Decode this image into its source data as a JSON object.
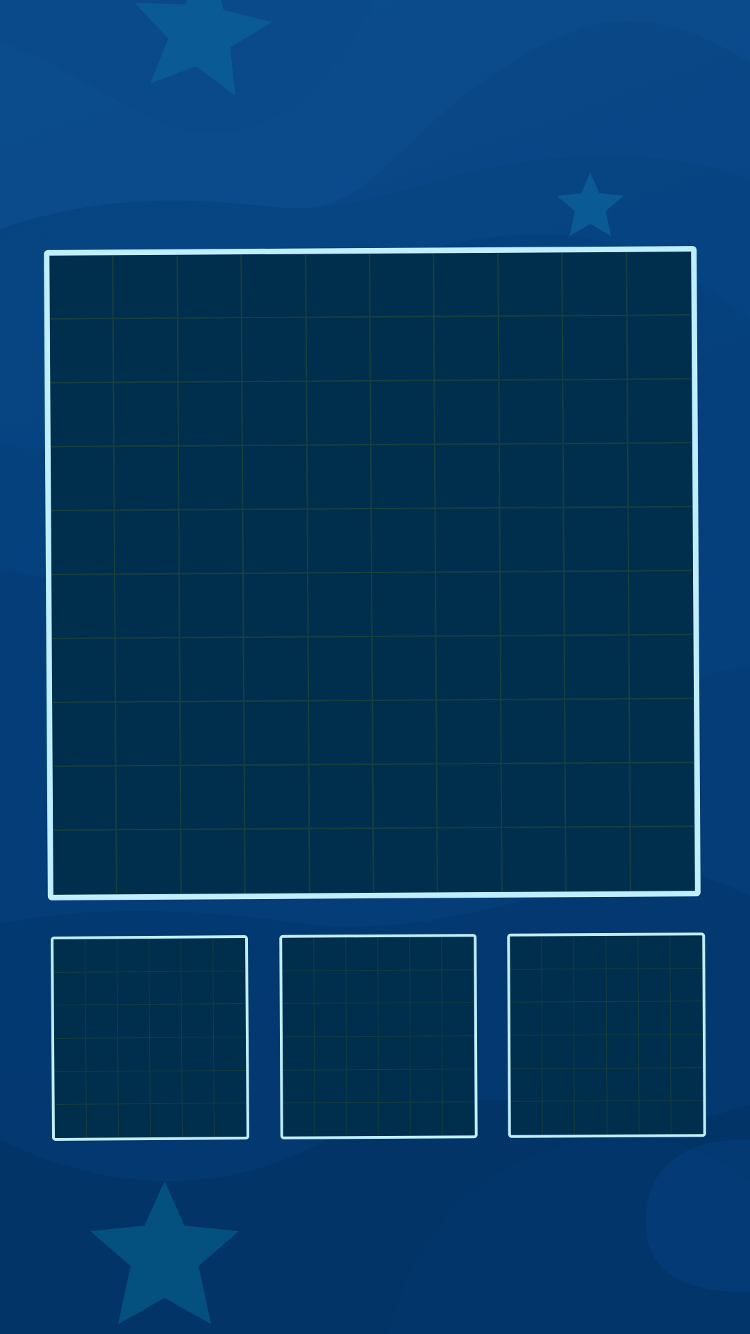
{
  "game": {
    "board": {
      "rows": 10,
      "cols": 10
    },
    "trays": [
      {
        "id": "tray-1",
        "rows": 6,
        "cols": 6
      },
      {
        "id": "tray-2",
        "rows": 6,
        "cols": 6
      },
      {
        "id": "tray-3",
        "rows": 6,
        "cols": 6
      }
    ]
  },
  "colors": {
    "background": "#074487",
    "board_fill": "#002e4d",
    "board_border": "#bfeefe",
    "grid_line": "#183f3e",
    "star": "#0a5a96"
  },
  "decorations": [
    "star-icon",
    "star-icon",
    "star-icon"
  ]
}
